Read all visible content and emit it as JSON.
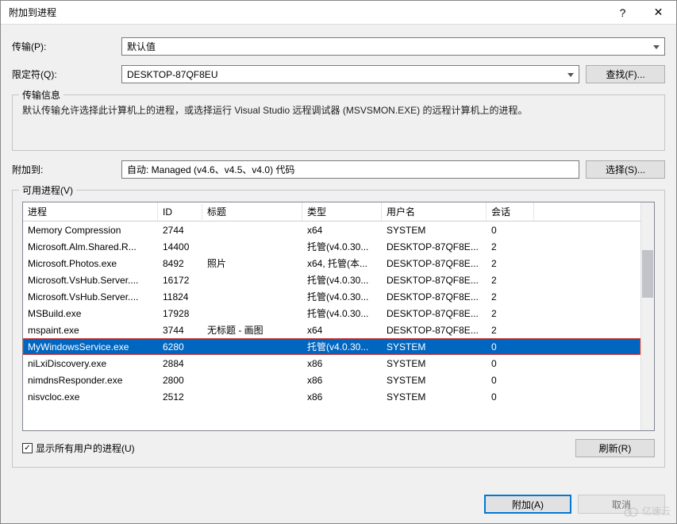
{
  "title": "附加到进程",
  "titlebar": {
    "help": "?",
    "close": "✕"
  },
  "labels": {
    "transport": "传输(P):",
    "qualifier": "限定符(Q):",
    "attach_to": "附加到:",
    "avail_proc": "可用进程(V)",
    "trans_info_title": "传输信息",
    "show_all": "显示所有用户的进程(U)"
  },
  "values": {
    "transport": "默认值",
    "qualifier": "DESKTOP-87QF8EU",
    "attach_to": "自动: Managed (v4.6、v4.5、v4.0) 代码"
  },
  "buttons": {
    "find": "查找(F)...",
    "select": "选择(S)...",
    "refresh": "刷新(R)",
    "attach": "附加(A)",
    "cancel": "取消"
  },
  "trans_info_text": "默认传输允许选择此计算机上的进程，或选择运行 Visual Studio 远程调试器 (MSVSMON.EXE) 的远程计算机上的进程。",
  "columns": {
    "proc": "进程",
    "id": "ID",
    "title_col": "标题",
    "type": "类型",
    "user": "用户名",
    "session": "会话"
  },
  "rows": [
    {
      "proc": "Memory Compression",
      "id": "2744",
      "title": "",
      "type": "x64",
      "user": "SYSTEM",
      "session": "0",
      "selected": false
    },
    {
      "proc": "Microsoft.Alm.Shared.R...",
      "id": "14400",
      "title": "",
      "type": "托管(v4.0.30...",
      "user": "DESKTOP-87QF8E...",
      "session": "2",
      "selected": false
    },
    {
      "proc": "Microsoft.Photos.exe",
      "id": "8492",
      "title": "照片",
      "type": "x64, 托管(本...",
      "user": "DESKTOP-87QF8E...",
      "session": "2",
      "selected": false
    },
    {
      "proc": "Microsoft.VsHub.Server....",
      "id": "16172",
      "title": "",
      "type": "托管(v4.0.30...",
      "user": "DESKTOP-87QF8E...",
      "session": "2",
      "selected": false
    },
    {
      "proc": "Microsoft.VsHub.Server....",
      "id": "11824",
      "title": "",
      "type": "托管(v4.0.30...",
      "user": "DESKTOP-87QF8E...",
      "session": "2",
      "selected": false
    },
    {
      "proc": "MSBuild.exe",
      "id": "17928",
      "title": "",
      "type": "托管(v4.0.30...",
      "user": "DESKTOP-87QF8E...",
      "session": "2",
      "selected": false
    },
    {
      "proc": "mspaint.exe",
      "id": "3744",
      "title": "无标题 - 画图",
      "type": "x64",
      "user": "DESKTOP-87QF8E...",
      "session": "2",
      "selected": false
    },
    {
      "proc": "MyWindowsService.exe",
      "id": "6280",
      "title": "",
      "type": "托管(v4.0.30...",
      "user": "SYSTEM",
      "session": "0",
      "selected": true
    },
    {
      "proc": "niLxiDiscovery.exe",
      "id": "2884",
      "title": "",
      "type": "x86",
      "user": "SYSTEM",
      "session": "0",
      "selected": false
    },
    {
      "proc": "nimdnsResponder.exe",
      "id": "2800",
      "title": "",
      "type": "x86",
      "user": "SYSTEM",
      "session": "0",
      "selected": false
    },
    {
      "proc": "nisvcloc.exe",
      "id": "2512",
      "title": "",
      "type": "x86",
      "user": "SYSTEM",
      "session": "0",
      "selected": false
    }
  ],
  "show_all_checked": true,
  "watermark": "亿速云"
}
